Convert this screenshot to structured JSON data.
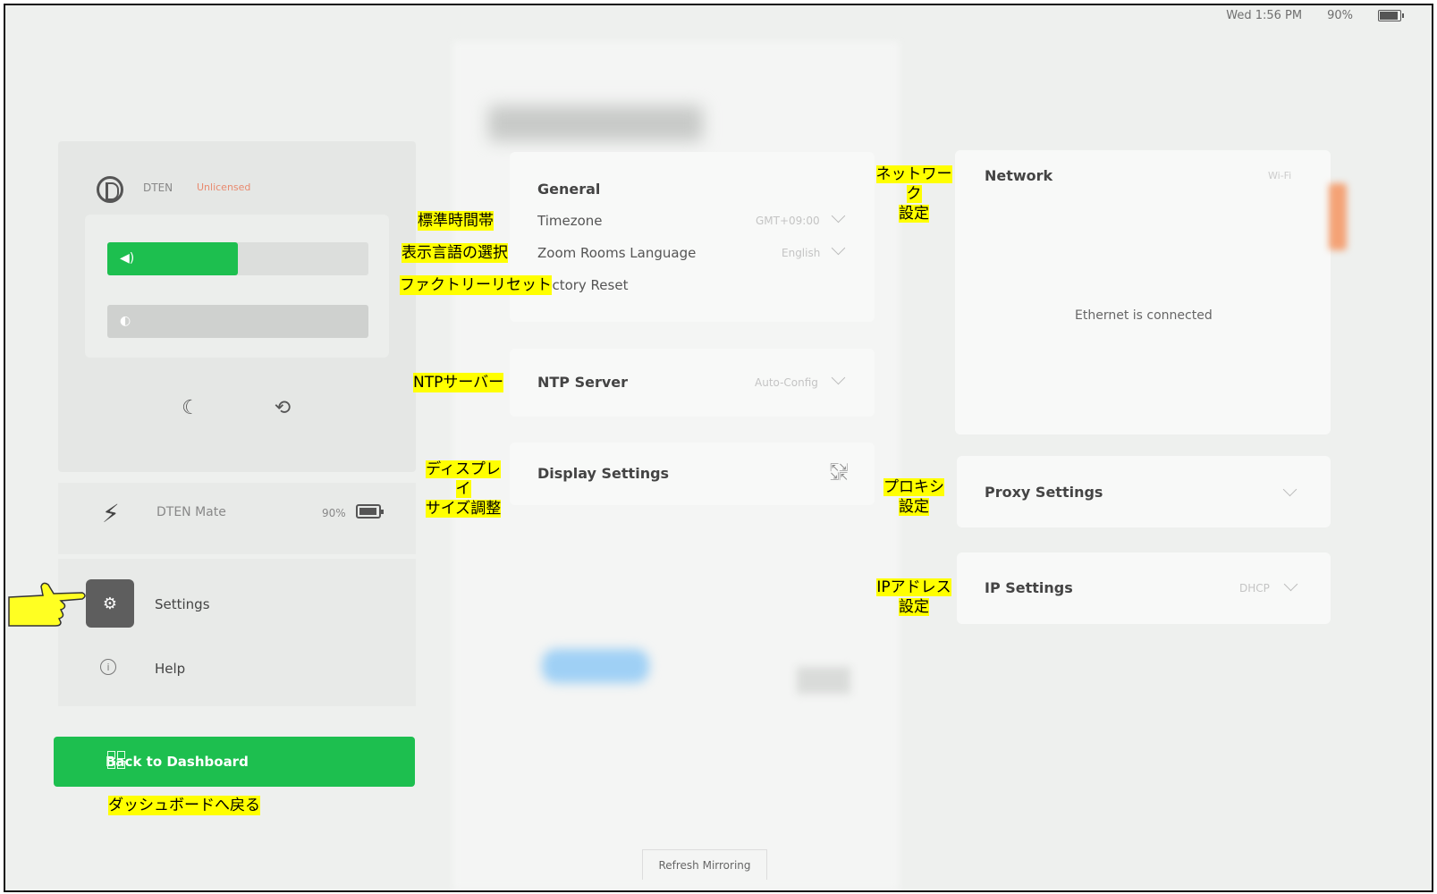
{
  "status_bar": {
    "datetime": "Wed 1:56 PM",
    "battery": "90%"
  },
  "device": {
    "name": "DTEN",
    "license": "Unlicensed"
  },
  "controls": {
    "volume_level": 0.5,
    "brightness_level": 0.0
  },
  "mate": {
    "name": "DTEN Mate",
    "battery": "90%"
  },
  "nav": {
    "settings": "Settings",
    "help": "Help"
  },
  "back_button": "Back to Dashboard",
  "general": {
    "title": "General",
    "timezone_label": "Timezone",
    "timezone_value": "GMT+09:00",
    "language_label": "Zoom Rooms Language",
    "language_value": "English",
    "factory_reset": "Factory Reset"
  },
  "ntp": {
    "label": "NTP Server",
    "value": "Auto-Config"
  },
  "display": {
    "label": "Display Settings"
  },
  "network": {
    "title": "Network",
    "value": "Wi-Fi",
    "status": "Ethernet is connected"
  },
  "proxy": {
    "label": "Proxy Settings"
  },
  "ip": {
    "label": "IP Settings",
    "value": "DHCP"
  },
  "refresh_button": "Refresh Mirroring",
  "annotations": {
    "timezone": "標準時間帯",
    "language": "表示言語の選択",
    "factory_reset": "ファクトリーリセット",
    "ntp": "NTPサーバー",
    "display_line1": "ディスプレイ",
    "display_line2": "サイズ調整",
    "network_line1": "ネットワーク",
    "network_line2": "設定",
    "proxy_line1": "プロキシ",
    "proxy_line2": "設定",
    "ip_line1": "IPアドレス",
    "ip_line2": "設定",
    "back": "ダッシュボードへ戻る"
  }
}
